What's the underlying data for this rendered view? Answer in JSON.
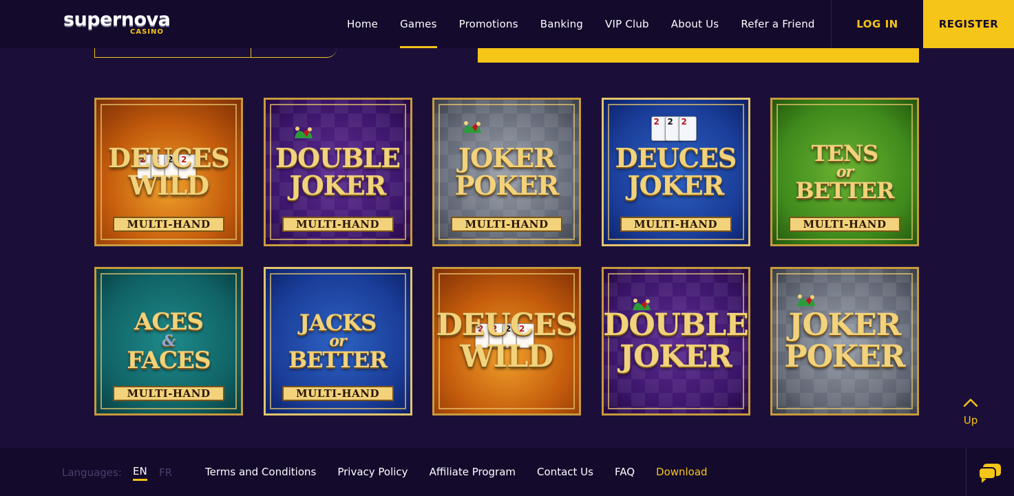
{
  "brand": {
    "logo_main": "supernova",
    "logo_sub": "CASINO"
  },
  "nav": {
    "items": [
      {
        "label": "Home"
      },
      {
        "label": "Games"
      },
      {
        "label": "Promotions"
      },
      {
        "label": "Banking"
      },
      {
        "label": "VIP Club"
      },
      {
        "label": "About Us"
      },
      {
        "label": "Refer a Friend"
      }
    ],
    "active": "Games",
    "login": "LOG IN",
    "register": "REGISTER"
  },
  "games": [
    {
      "line1": "Deuces",
      "line2": "",
      "line3": "Wild",
      "tag": "MULTI-HAND",
      "theme": "orange"
    },
    {
      "line1": "Double",
      "line2": "",
      "line3": "Joker",
      "tag": "MULTI-HAND",
      "theme": "purple"
    },
    {
      "line1": "Joker",
      "line2": "",
      "line3": "Poker",
      "tag": "MULTI-HAND",
      "theme": "silver"
    },
    {
      "line1": "Deuces",
      "line2": "",
      "line3": "Joker",
      "tag": "MULTI-HAND",
      "theme": "blue"
    },
    {
      "line1": "Tens",
      "line2": "or",
      "line3": "Better",
      "tag": "MULTI-HAND",
      "theme": "green"
    },
    {
      "line1": "Aces",
      "line2": "&",
      "line3": "Faces",
      "tag": "MULTI-HAND",
      "theme": "teal"
    },
    {
      "line1": "Jacks",
      "line2": "or",
      "line3": "Better",
      "tag": "MULTI-HAND",
      "theme": "blue"
    },
    {
      "line1": "Deuces",
      "line2": "",
      "line3": "Wild",
      "tag": "",
      "theme": "orange"
    },
    {
      "line1": "Double",
      "line2": "",
      "line3": "Joker",
      "tag": "",
      "theme": "purple"
    },
    {
      "line1": "Joker",
      "line2": "",
      "line3": "Poker",
      "tag": "",
      "theme": "silver"
    }
  ],
  "up_button": {
    "label": "Up",
    "icon": "chevron-up-icon"
  },
  "footer": {
    "languages_label": "Languages:",
    "lang_en": "EN",
    "lang_fr": "FR",
    "links": [
      {
        "label": "Terms and Conditions"
      },
      {
        "label": "Privacy Policy"
      },
      {
        "label": "Affiliate Program"
      },
      {
        "label": "Contact Us"
      },
      {
        "label": "FAQ"
      },
      {
        "label": "Download"
      }
    ],
    "chat_icon": "chat-icon"
  },
  "colors": {
    "accent": "#f5c518",
    "background": "#1b0f3a",
    "header_bg": "#140a2c"
  }
}
